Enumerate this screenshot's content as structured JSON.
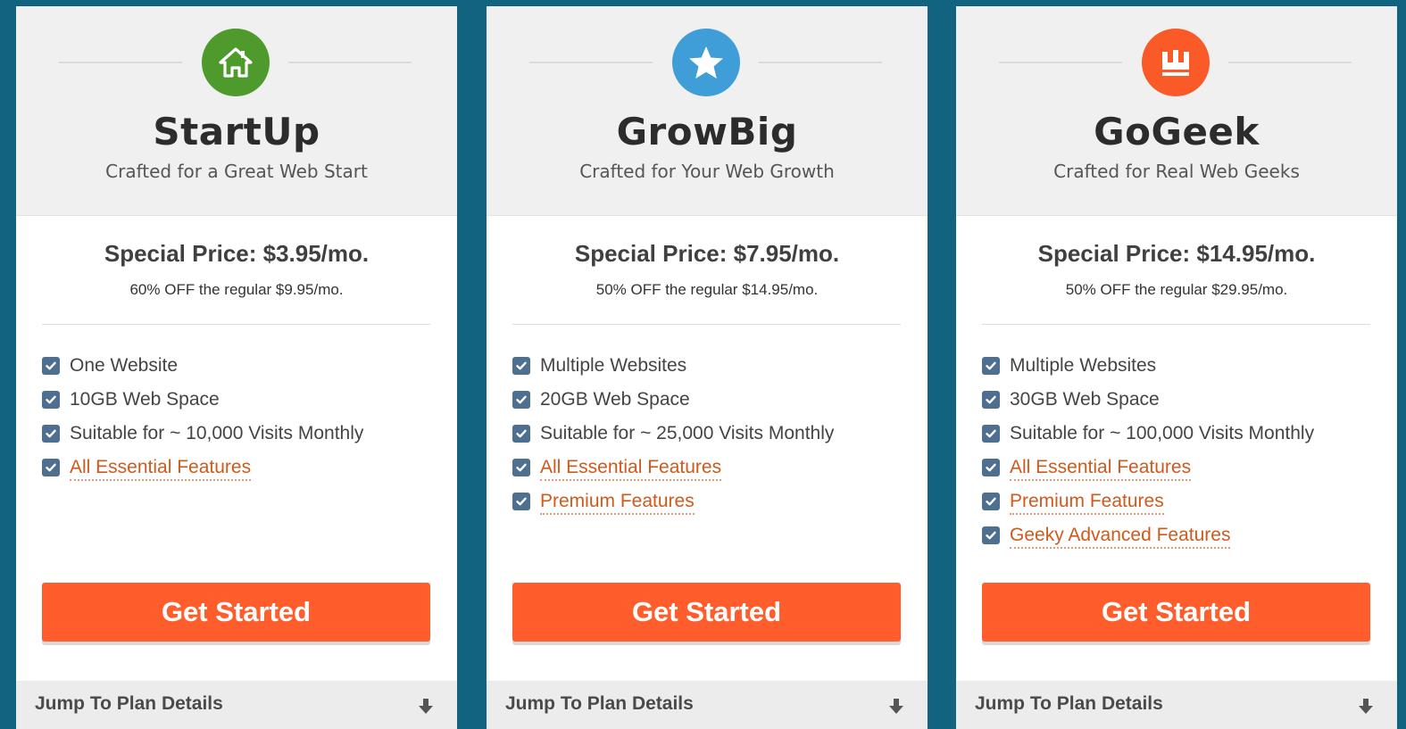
{
  "colors": {
    "page_background": "#11637f",
    "cta": "#ff5e2c",
    "checkbox": "#4e6f8f",
    "feature_link": "#cf5a1c"
  },
  "plans": [
    {
      "name": "StartUp",
      "tagline": "Crafted for a Great Web Start",
      "icon": "house-icon",
      "icon_color": "#4e9a2c",
      "price": "Special Price: $3.95/mo.",
      "discount": "60% OFF the regular $9.95/mo.",
      "features": [
        {
          "text": "One Website",
          "link": false
        },
        {
          "text": "10GB Web Space",
          "link": false
        },
        {
          "text": "Suitable for ~ 10,000 Visits Monthly",
          "link": false
        },
        {
          "text": "All Essential Features",
          "link": true
        }
      ],
      "cta_label": "Get Started",
      "jump_label": "Jump To Plan Details"
    },
    {
      "name": "GrowBig",
      "tagline": "Crafted for Your Web Growth",
      "icon": "star-icon",
      "icon_color": "#3f9ed8",
      "price": "Special Price: $7.95/mo.",
      "discount": "50% OFF the regular $14.95/mo.",
      "features": [
        {
          "text": "Multiple Websites",
          "link": false
        },
        {
          "text": "20GB Web Space",
          "link": false
        },
        {
          "text": "Suitable for ~ 25,000 Visits Monthly",
          "link": false
        },
        {
          "text": "All Essential Features",
          "link": true
        },
        {
          "text": "Premium Features",
          "link": true
        }
      ],
      "cta_label": "Get Started",
      "jump_label": "Jump To Plan Details"
    },
    {
      "name": "GoGeek",
      "tagline": "Crafted for Real Web Geeks",
      "icon": "crown-icon",
      "icon_color": "#f95a28",
      "price": "Special Price: $14.95/mo.",
      "discount": "50% OFF the regular $29.95/mo.",
      "features": [
        {
          "text": "Multiple Websites",
          "link": false
        },
        {
          "text": "30GB Web Space",
          "link": false
        },
        {
          "text": "Suitable for ~ 100,000 Visits Monthly",
          "link": false
        },
        {
          "text": "All Essential Features",
          "link": true
        },
        {
          "text": "Premium Features",
          "link": true
        },
        {
          "text": "Geeky Advanced Features",
          "link": true
        }
      ],
      "cta_label": "Get Started",
      "jump_label": "Jump To Plan Details"
    }
  ]
}
